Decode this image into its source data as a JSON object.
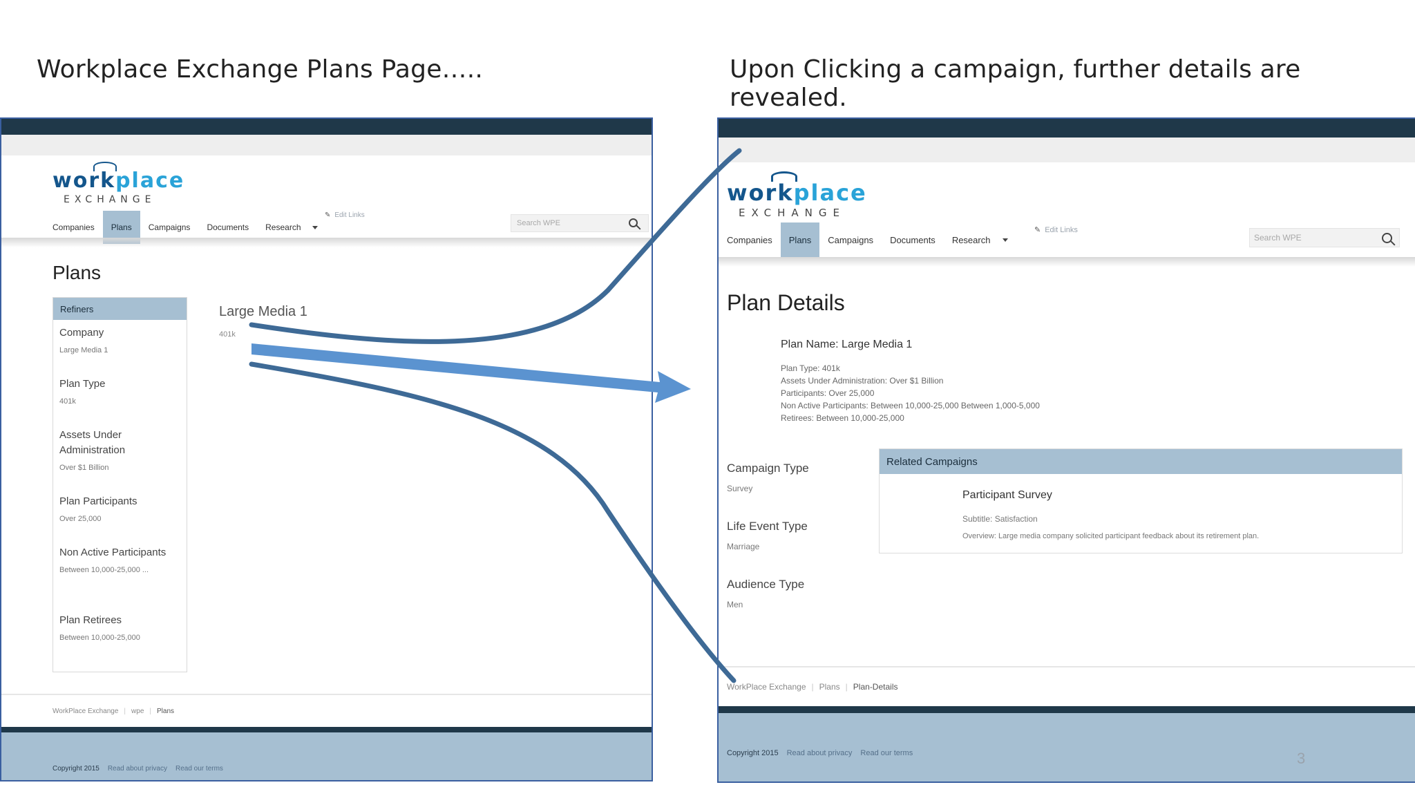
{
  "slide": {
    "left_title": "Workplace Exchange Plans Page…..",
    "right_title": "Upon Clicking a campaign, further details are revealed.",
    "slide_number": "3"
  },
  "logo": {
    "word_main": "work",
    "word_accent": "place",
    "subtitle": "EXCHANGE"
  },
  "nav": {
    "items": [
      "Companies",
      "Plans",
      "Campaigns",
      "Documents",
      "Research"
    ],
    "active": "Plans",
    "edit_links": "Edit Links",
    "search_placeholder": "Search WPE"
  },
  "left": {
    "page_title": "Plans",
    "refiners_label": "Refiners",
    "refiners": [
      {
        "label": "Company",
        "value": "Large Media 1"
      },
      {
        "label": "Plan Type",
        "value": "401k"
      },
      {
        "label": "Assets Under Administration",
        "value": "Over $1 Billion"
      },
      {
        "label": "Plan Participants",
        "value": "Over 25,000"
      },
      {
        "label": "Non Active Participants",
        "value": "Between 10,000-25,000 ..."
      },
      {
        "label": "Plan Retirees",
        "value": "Between 10,000-25,000"
      }
    ],
    "result": {
      "title": "Large Media 1",
      "subtitle": "401k"
    },
    "breadcrumb": [
      "WorkPlace Exchange",
      "wpe",
      "Plans"
    ],
    "copyright": "Copyright 2015",
    "privacy_link": "Read about privacy",
    "terms_link": "Read our terms"
  },
  "right": {
    "page_title": "Plan Details",
    "plan_name": "Plan Name: Large Media 1",
    "plan_details": [
      "Plan Type: 401k",
      "Assets Under Administration: Over $1 Billion",
      "Participants: Over 25,000",
      "Non Active Participants: Between 10,000-25,000 Between 1,000-5,000",
      "Retirees: Between 10,000-25,000"
    ],
    "types": [
      {
        "label": "Campaign Type",
        "value": "Survey"
      },
      {
        "label": "Life Event Type",
        "value": "Marriage"
      },
      {
        "label": "Audience Type",
        "value": "Men"
      }
    ],
    "related": {
      "header": "Related Campaigns",
      "title": "Participant Survey",
      "subtitle": "Subtitle: Satisfaction",
      "overview": "Overview: Large media company solicited participant feedback about its retirement plan."
    },
    "breadcrumb": [
      "WorkPlace Exchange",
      "Plans",
      "Plan-Details"
    ],
    "copyright": "Copyright 2015",
    "privacy_link": "Read about privacy",
    "terms_link": "Read our terms"
  },
  "colors": {
    "brand_dark": "#1f3849",
    "accent_blue": "#a6bfd2",
    "logo_blue": "#14568c",
    "logo_cyan": "#2aa3d8",
    "arrow_dark": "#3e6a96",
    "arrow_light": "#5b93d0"
  }
}
